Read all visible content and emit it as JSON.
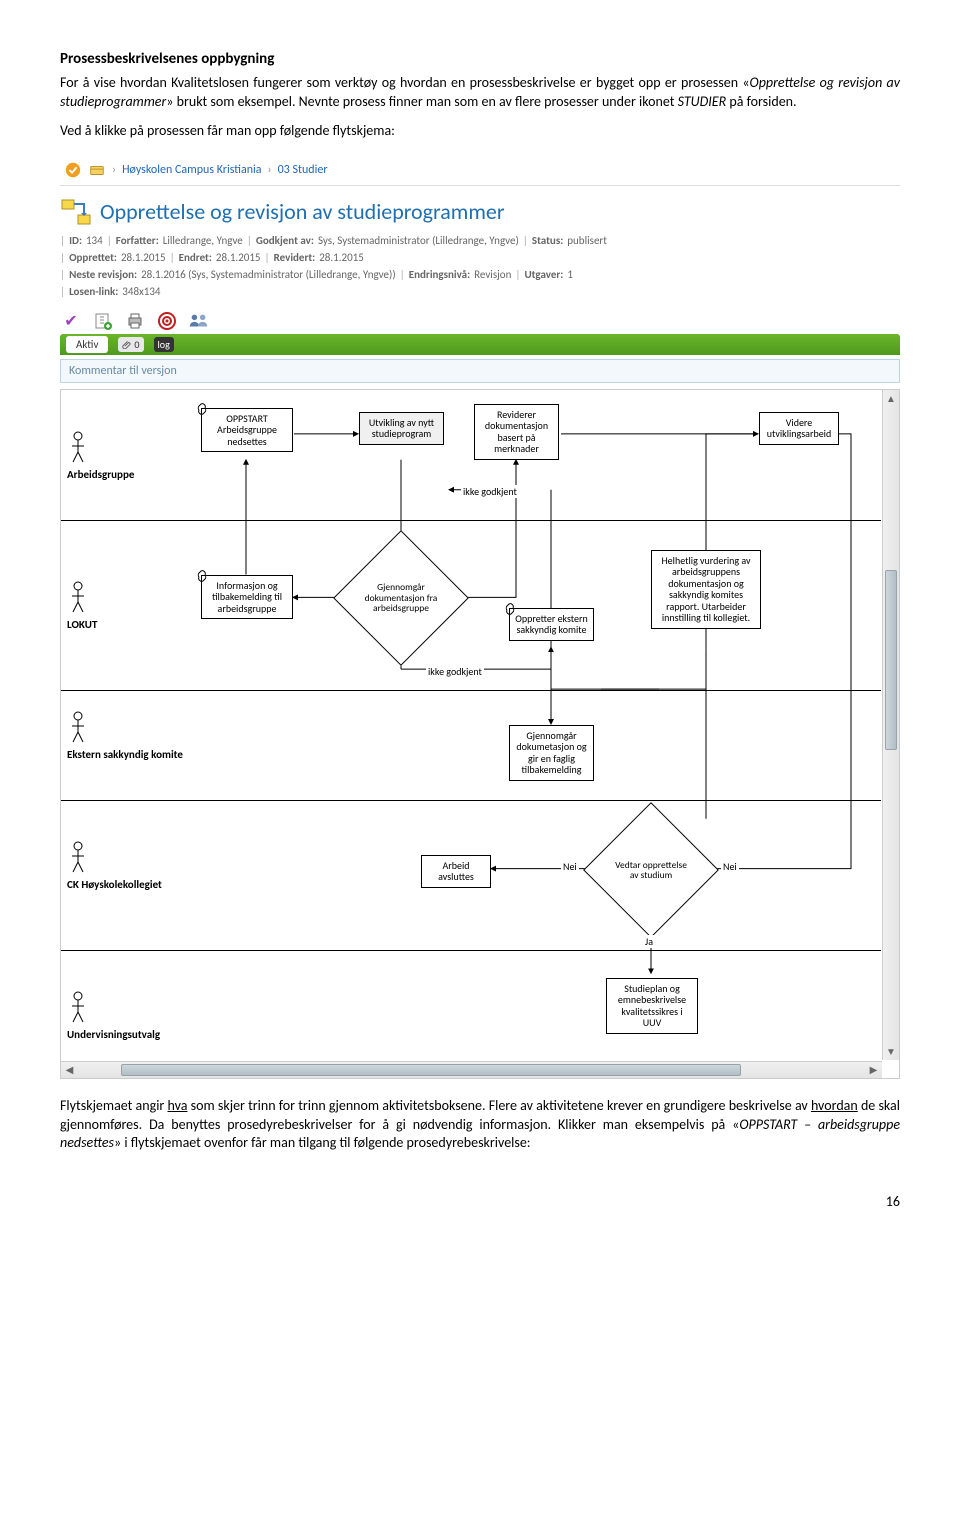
{
  "doc": {
    "heading": "Prosessbeskrivelsenes oppbygning",
    "para1_a": "For å vise hvordan Kvalitetslosen fungerer som verktøy og hvordan en prosessbeskrivelse er bygget opp er prosessen «",
    "para1_em": "Opprettelse og revisjon av studieprogrammer",
    "para1_b": "» brukt som eksempel. Nevnte prosess finner man som en av flere prosesser under ikonet ",
    "para1_em2": "STUDIER",
    "para1_c": " på forsiden.",
    "para2": "Ved å klikke på prosessen får man opp følgende flytskjema:",
    "para3_a": "Flytskjemaet angir ",
    "para3_u1": "hva",
    "para3_b": " som skjer trinn for trinn gjennom aktivitetsboksene. Flere av aktivitetene krever en grundigere beskrivelse av ",
    "para3_u2": "hvordan",
    "para3_c": " de skal gjennomføres. Da benyttes prosedyre­beskrivelser for å gi nødvendig informasjon. Klikker man eksempelvis på «",
    "para3_em": "OPPSTART – arbeidsgruppe nedsettes",
    "para3_d": "» i flytskjemaet ovenfor får man tilgang til følgende prosedyrebeskrivelse:",
    "pagenum": "16"
  },
  "breadcrumb": {
    "item1": "Høyskolen Campus Kristiania",
    "item2": "03 Studier"
  },
  "proc": {
    "title": "Opprettelse og revisjon av studieprogrammer"
  },
  "meta": {
    "l1": {
      "id_k": "ID:",
      "id_v": "134",
      "forf_k": "Forfatter:",
      "forf_v": "Lilledrange, Yngve",
      "godk_k": "Godkjent av:",
      "godk_v": "Sys, Systemadministrator (Lilledrange, Yngve)",
      "stat_k": "Status:",
      "stat_v": "publisert"
    },
    "l2": {
      "oppr_k": "Opprettet:",
      "oppr_v": "28.1.2015",
      "endr_k": "Endret:",
      "endr_v": "28.1.2015",
      "rev_k": "Revidert:",
      "rev_v": "28.1.2015"
    },
    "l3": {
      "nrev_k": "Neste revisjon:",
      "nrev_v": "28.1.2016 (Sys, Systemadministrator (Lilledrange, Yngve))",
      "eniv_k": "Endringsnivå:",
      "eniv_v": "Revisjon",
      "utg_k": "Utgaver:",
      "utg_v": "1"
    },
    "l4": {
      "losen_k": "Losen-link:",
      "losen_v": "348x134"
    }
  },
  "tabs": {
    "active": "Aktiv",
    "chip1": "0",
    "chip2": "log"
  },
  "comment": "Kommentar til versjon",
  "lanes": {
    "l0": "Arbeidsgruppe",
    "l1": "LOKUT",
    "l2": "Ekstern sakkyndig komite",
    "l3": "CK Høyskolekollegiet",
    "l4": "Undervisningsutvalg"
  },
  "nodes": {
    "n1": "OPPSTART Arbeidsgruppe nedsettes",
    "n2": "Utvikling av nytt studieprogram",
    "n3": "Reviderer dokumentasjon basert på merknader",
    "n4": "Videre utviklingsarbeid",
    "n5": "Informasjon og tilbakemelding til arbeidsgruppe",
    "n6": "Gjennomgår dokumentasjon fra arbeidsgruppe",
    "n7": "Oppretter ekstern sakkyndig komite",
    "n8": "Helhetlig vurdering av arbeidsgruppens dokumentasjon og sakkyndig komites rapport. Utarbeider innstilling til kollegiet.",
    "n9": "Gjennomgår dokumetasjon og gir en faglig tilbakemelding",
    "n10": "Arbeid avsluttes",
    "n11": "Vedtar opprettelse av studium",
    "n12": "Studieplan og emnebeskrivelse kvalitetssikres i UUV"
  },
  "edges": {
    "e1": "ikke godkjent",
    "e2": "ikke godkjent",
    "e3": "Nei",
    "e4": "Nei",
    "e5": "Ja"
  }
}
